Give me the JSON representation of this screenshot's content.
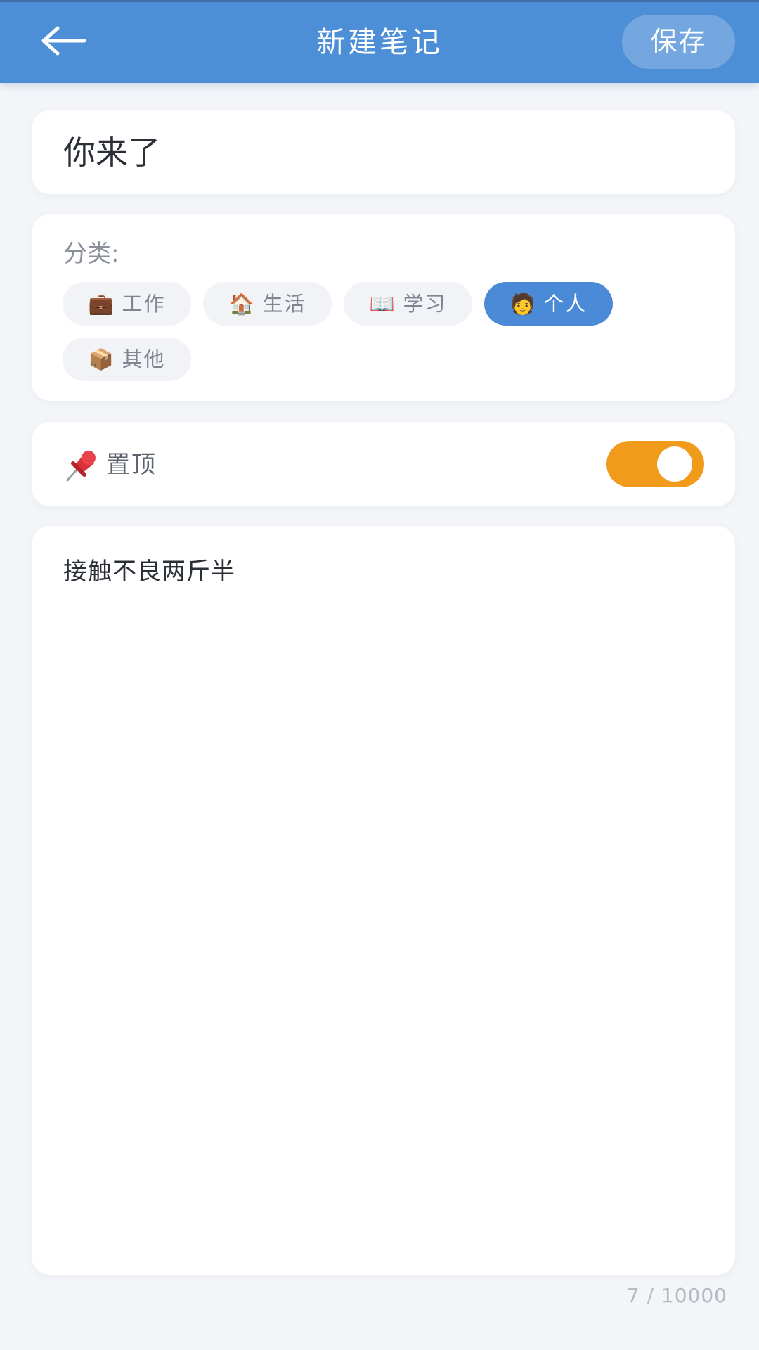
{
  "header": {
    "title": "新建笔记",
    "save_label": "保存",
    "background_color": "#4d8fd6",
    "back_icon": "arrow-left-icon"
  },
  "note": {
    "title_value": "你来了",
    "content_value": "接触不良两斤半"
  },
  "category": {
    "label": "分类:",
    "selected_color": "#4a8ad6",
    "options": [
      {
        "emoji": "💼",
        "label": "工作",
        "selected": false
      },
      {
        "emoji": "🏠",
        "label": "生活",
        "selected": false
      },
      {
        "emoji": "📖",
        "label": "学习",
        "selected": false
      },
      {
        "emoji": "🧑",
        "label": "个人",
        "selected": true
      },
      {
        "emoji": "📦",
        "label": "其他",
        "selected": false
      }
    ]
  },
  "pin": {
    "label": "置顶",
    "icon": "pushpin-icon",
    "enabled": true,
    "toggle_color": "#f09b1b"
  },
  "char_count": "7 / 10000"
}
